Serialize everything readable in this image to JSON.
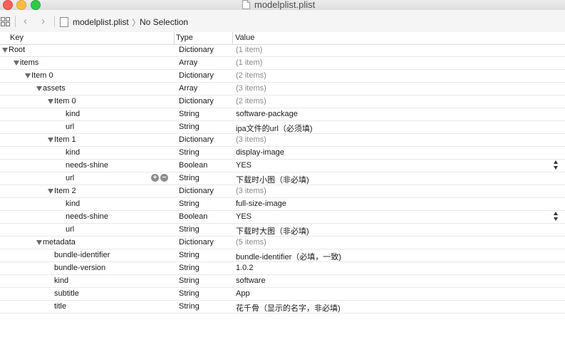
{
  "window": {
    "title": "modelplist.plist"
  },
  "jumpbar": {
    "back_icon": "chevron-left-icon",
    "forward_icon": "chevron-right-icon",
    "file": "modelplist.plist",
    "selection": "No Selection"
  },
  "header": {
    "key": "Key",
    "type": "Type",
    "value": "Value"
  },
  "rows": [
    {
      "key": "Root",
      "type": "Dictionary",
      "value": "(1 item)",
      "indent": 0,
      "disclosure": true,
      "muted": true
    },
    {
      "key": "items",
      "type": "Array",
      "value": "(1 item)",
      "indent": 1,
      "disclosure": true,
      "muted": true
    },
    {
      "key": "Item 0",
      "type": "Dictionary",
      "value": "(2 items)",
      "indent": 2,
      "disclosure": true,
      "muted": true
    },
    {
      "key": "assets",
      "type": "Array",
      "value": "(3 items)",
      "indent": 3,
      "disclosure": true,
      "muted": true
    },
    {
      "key": "Item 0",
      "type": "Dictionary",
      "value": "(2 items)",
      "indent": 4,
      "disclosure": true,
      "muted": true
    },
    {
      "key": "kind",
      "type": "String",
      "value": "software-package",
      "indent": 5,
      "disclosure": false,
      "muted": false
    },
    {
      "key": "url",
      "type": "String",
      "value": "ipa文件的url（必须填)",
      "indent": 5,
      "disclosure": false,
      "muted": false
    },
    {
      "key": "Item 1",
      "type": "Dictionary",
      "value": "(3 items)",
      "indent": 4,
      "disclosure": true,
      "muted": true
    },
    {
      "key": "kind",
      "type": "String",
      "value": "display-image",
      "indent": 5,
      "disclosure": false,
      "muted": false
    },
    {
      "key": "needs-shine",
      "type": "Boolean",
      "value": "YES",
      "indent": 5,
      "disclosure": false,
      "muted": false,
      "stepper": true
    },
    {
      "key": "url",
      "type": "String",
      "value": "下载时小图（非必填)",
      "indent": 5,
      "disclosure": false,
      "muted": false,
      "rowbuttons": true
    },
    {
      "key": "Item 2",
      "type": "Dictionary",
      "value": "(3 items)",
      "indent": 4,
      "disclosure": true,
      "muted": true
    },
    {
      "key": "kind",
      "type": "String",
      "value": "full-size-image",
      "indent": 5,
      "disclosure": false,
      "muted": false
    },
    {
      "key": "needs-shine",
      "type": "Boolean",
      "value": "YES",
      "indent": 5,
      "disclosure": false,
      "muted": false,
      "stepper": true
    },
    {
      "key": "url",
      "type": "String",
      "value": "下载时大图（非必填)",
      "indent": 5,
      "disclosure": false,
      "muted": false
    },
    {
      "key": "metadata",
      "type": "Dictionary",
      "value": "(5 items)",
      "indent": 3,
      "disclosure": true,
      "muted": true
    },
    {
      "key": "bundle-identifier",
      "type": "String",
      "value": "bundle-identifier（必填，一致)",
      "indent": 4,
      "disclosure": false,
      "muted": false
    },
    {
      "key": "bundle-version",
      "type": "String",
      "value": "1.0.2",
      "indent": 4,
      "disclosure": false,
      "muted": false
    },
    {
      "key": "kind",
      "type": "String",
      "value": "software",
      "indent": 4,
      "disclosure": false,
      "muted": false
    },
    {
      "key": "subtitle",
      "type": "String",
      "value": "App",
      "indent": 4,
      "disclosure": false,
      "muted": false
    },
    {
      "key": "title",
      "type": "String",
      "value": "花千骨（显示的名字，非必填)",
      "indent": 4,
      "disclosure": false,
      "muted": false
    }
  ]
}
